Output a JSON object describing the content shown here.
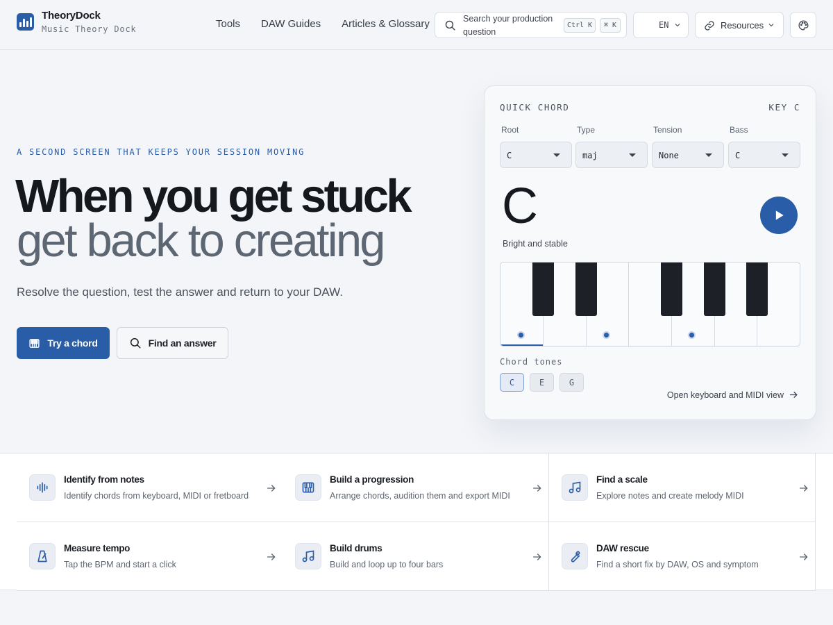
{
  "brand": {
    "name": "TheoryDock",
    "subtitle": "Music Theory Dock"
  },
  "nav": [
    "Tools",
    "DAW Guides",
    "Articles & Glossary"
  ],
  "search": {
    "placeholder": "Search your production question",
    "shortcut_win": "Ctrl K",
    "shortcut_mac": "⌘ K"
  },
  "language": "EN",
  "resources_label": "Resources",
  "hero": {
    "eyebrow": "A SECOND SCREEN THAT KEEPS YOUR SESSION MOVING",
    "title_line1": "When you get stuck",
    "title_line2": "get back to creating",
    "lead": "Resolve the question, test the answer and return to your DAW.",
    "primary_cta": "Try a chord",
    "secondary_cta": "Find an answer"
  },
  "quick_chord": {
    "title": "QUICK CHORD",
    "key_label": "KEY C",
    "selects": [
      {
        "label": "Root",
        "value": "C"
      },
      {
        "label": "Type",
        "value": "maj"
      },
      {
        "label": "Tension",
        "value": "None"
      },
      {
        "label": "Bass",
        "value": "C"
      }
    ],
    "chord_name": "C",
    "description": "Bright and stable",
    "tones_label": "Chord tones",
    "tones": [
      "C",
      "E",
      "G"
    ],
    "open_link": "Open keyboard and MIDI view"
  },
  "tools": [
    {
      "title": "Identify from notes",
      "desc": "Identify chords from keyboard, MIDI or fretboard",
      "icon": "waveform-icon"
    },
    {
      "title": "Build a progression",
      "desc": "Arrange chords, audition them and export MIDI",
      "icon": "piano-icon"
    },
    {
      "title": "Find a scale",
      "desc": "Explore notes and create melody MIDI",
      "icon": "music-note-icon"
    },
    {
      "title": "Measure tempo",
      "desc": "Tap the BPM and start a click",
      "icon": "metronome-icon"
    },
    {
      "title": "Build drums",
      "desc": "Build and loop up to four bars",
      "icon": "music-note-icon"
    },
    {
      "title": "DAW rescue",
      "desc": "Find a short fix by DAW, OS and symptom",
      "icon": "wrench-icon"
    }
  ],
  "colors": {
    "accent": "#2a5da8",
    "background": "#f3f5f8"
  }
}
